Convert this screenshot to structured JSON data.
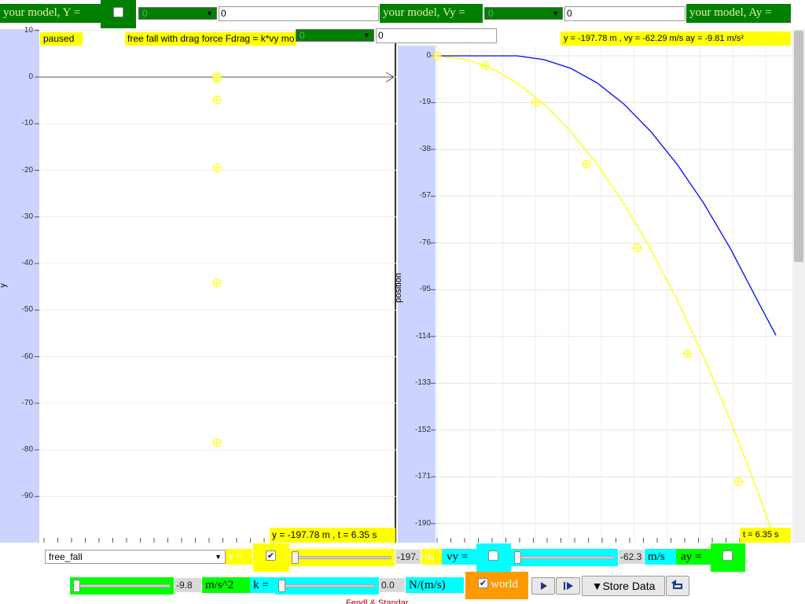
{
  "top_bar": {
    "model_y_label": "your model, Y =",
    "model_y_select": "0",
    "model_y_input": "0",
    "model_vy_label": "your model, Vy =",
    "model_vy_select": "0",
    "model_vy_input": "0",
    "model_ay_label": "your model, Ay =",
    "model_ay_select": "0",
    "model_ay_input": "0"
  },
  "left_panel": {
    "status": "paused",
    "title": "free fall with drag force Fdrag = k*vy mo",
    "axis_label": "y",
    "readout": "y = -197.78 m , t = 6.35 s",
    "ticks": [
      "10",
      "0",
      "-10",
      "-20",
      "-30",
      "-40",
      "-50",
      "-60",
      "-70",
      "-80",
      "-90"
    ]
  },
  "right_panel": {
    "readout": "y = -197.78 m , vy = -62.29 m/s ay = -9.81 m/s²",
    "axis_label": "position",
    "time_readout": "t = 6.35 s",
    "ticks": [
      "0",
      "-19",
      "-38",
      "-57",
      "-76",
      "-95",
      "-114",
      "-133",
      "-152",
      "-171",
      "-190"
    ]
  },
  "chart_data": {
    "type": "line",
    "ylabel": "position",
    "ylim": [
      -199,
      4
    ],
    "xlim": [
      0,
      6.35
    ],
    "grid": true,
    "series": [
      {
        "color": "#ffff00",
        "x": [
          0,
          0.5,
          1.0,
          1.5,
          2.0,
          2.5,
          3.0,
          3.5,
          4.0,
          4.5,
          5.0,
          5.5,
          6.0,
          6.35
        ],
        "values": [
          0,
          -1.2,
          -4.9,
          -11.0,
          -19.6,
          -30.6,
          -44.1,
          -60.0,
          -78.4,
          -99.2,
          -122.5,
          -148.2,
          -176.4,
          -197.8
        ]
      },
      {
        "color": "#0000ff",
        "x": [
          0,
          1.0,
          1.5,
          2.0,
          2.5,
          3.0,
          3.5,
          4.0,
          4.5,
          5.0,
          5.5,
          6.0,
          6.35
        ],
        "values": [
          0,
          0,
          0,
          -1.5,
          -5.0,
          -11.0,
          -19.6,
          -30.6,
          -44.1,
          -60.0,
          -78.4,
          -99.2,
          -113.5
        ]
      }
    ],
    "markers": [
      {
        "x": 0,
        "y": 0
      },
      {
        "x": 0.9,
        "y": -4.0
      },
      {
        "x": 1.85,
        "y": -19.0
      },
      {
        "x": 2.8,
        "y": -44.0
      },
      {
        "x": 3.75,
        "y": -78.0
      },
      {
        "x": 4.7,
        "y": -121.0
      },
      {
        "x": 5.65,
        "y": -173.0
      }
    ]
  },
  "ball_positions": [
    0,
    -0.2,
    -4.9,
    -19.5,
    -44.2,
    -78.5
  ],
  "bottom": {
    "model_select": "free_fall",
    "y_label": "y =",
    "y_value": "-197.",
    "y_unit": "m",
    "vy_label": "vy =",
    "vy_value": "-62.3",
    "vy_unit": "m/s",
    "ay_label": "ay =",
    "ay_value": "-9.8",
    "ay_unit": "m/s^2",
    "k_label": "k =",
    "k_value": "0.0",
    "k_unit": "N/(m/s)",
    "world_label": "world",
    "store_label": "▼Store Data",
    "footer_text": "Fendl & Standar"
  }
}
